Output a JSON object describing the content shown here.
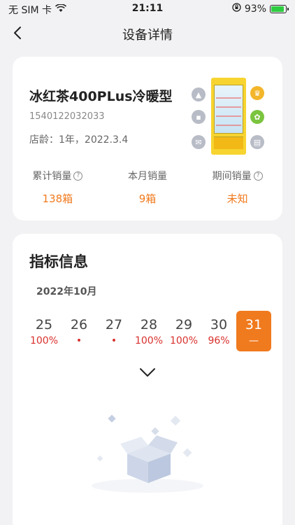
{
  "status_bar": {
    "carrier": "无 SIM 卡",
    "time": "21:11",
    "battery": "93%",
    "battery_level": 0.93
  },
  "nav": {
    "title": "设备详情"
  },
  "device": {
    "name": "冰红茶400PLus冷暖型",
    "id": "1540122032033",
    "age": "店龄：1年，2022.3.4"
  },
  "stats": [
    {
      "label": "累计销量",
      "value": "138箱",
      "help": true
    },
    {
      "label": "本月销量",
      "value": "9箱",
      "help": false
    },
    {
      "label": "期间销量",
      "value": "未知",
      "help": true
    }
  ],
  "indicators": {
    "title": "指标信息",
    "month": "2022年10月",
    "dates": [
      {
        "day": "25",
        "value": "100%",
        "selected": false
      },
      {
        "day": "26",
        "value": "•",
        "selected": false
      },
      {
        "day": "27",
        "value": "•",
        "selected": false
      },
      {
        "day": "28",
        "value": "100%",
        "selected": false
      },
      {
        "day": "29",
        "value": "100%",
        "selected": false
      },
      {
        "day": "30",
        "value": "96%",
        "selected": false
      },
      {
        "day": "31",
        "value": "—",
        "selected": true
      }
    ]
  },
  "colors": {
    "accent": "#f07a1e",
    "alert_red": "#d8302c"
  }
}
